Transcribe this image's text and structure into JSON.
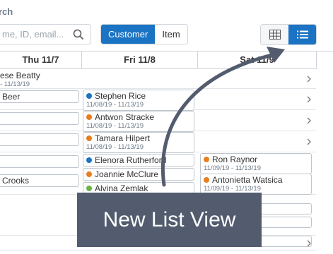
{
  "search": {
    "title": "rch",
    "placeholder": "me, ID, email..."
  },
  "toggle": {
    "customer": "Customer",
    "item": "Item"
  },
  "view_switch": {
    "grid_icon": "grid-icon",
    "list_icon": "list-icon"
  },
  "days": [
    "Thu 11/7",
    "Fri 11/8",
    "Sat 11/9"
  ],
  "rows": {
    "r1": {
      "name": "ese Beatty",
      "date": "- 11/13/19"
    },
    "thu": [
      "Beer",
      "",
      "",
      "",
      "Crooks"
    ],
    "fri": [
      {
        "name": "Stephen Rice",
        "date": "11/08/19 - 11/13/19",
        "color": "#1b73c3"
      },
      {
        "name": "Antwon Stracke",
        "date": "11/08/19 - 11/13/19",
        "color": "#e67e22"
      },
      {
        "name": "Tamara Hilpert",
        "date": "11/08/19 - 11/13/19",
        "color": "#e67e22"
      },
      {
        "name": "Elenora Rutherford",
        "color": "#1b73c3"
      },
      {
        "name": "Joannie McClure",
        "color": "#e67e22"
      },
      {
        "name": "Alvina Zemlak",
        "color": "#6ab344"
      }
    ],
    "sat": [
      {
        "name": "Ron Raynor",
        "date": "11/09/19 - 11/13/19",
        "color": "#e67e22"
      },
      {
        "name": "Antonietta Watsica",
        "date": "11/09/19 - 11/13/19",
        "color": "#e67e22"
      }
    ]
  },
  "overlay": {
    "text": "New List View"
  },
  "colors": {
    "accent": "#1b73c3",
    "overlay": "#525c6e",
    "arrow": "#525c6e"
  }
}
